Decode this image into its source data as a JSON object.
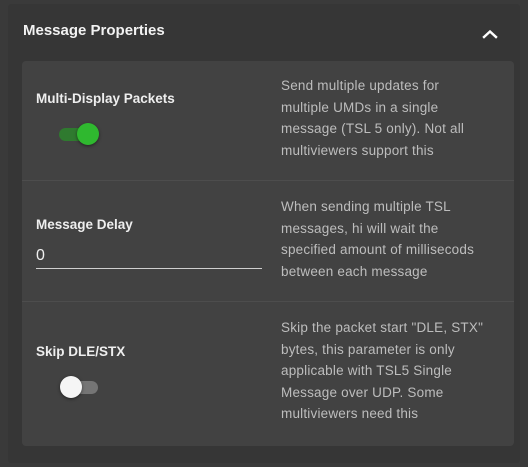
{
  "panel": {
    "title": "Message Properties",
    "collapse_icon": "chevron-up-icon"
  },
  "settings": [
    {
      "label": "Multi-Display Packets",
      "control": "toggle",
      "value": true,
      "description_lines": [
        "Send multiple updates for",
        "multiple UMDs in a single",
        "message (TSL 5 only). Not all",
        "multiviewers support this"
      ]
    },
    {
      "label": "Message Delay",
      "control": "text-field",
      "value": "0",
      "description_lines": [
        "When sending multiple TSL",
        "messages, hi will wait the",
        "specified amount of millisecods",
        "between each message"
      ]
    },
    {
      "label": "Skip DLE/STX",
      "control": "toggle",
      "value": false,
      "description_lines": [
        "Skip the packet start \"DLE, STX\"",
        "bytes, this parameter is only",
        "applicable with TSL5 Single",
        "Message over UDP. Some",
        "multiviewers need this"
      ]
    }
  ],
  "colors": {
    "toggle_on": "#2fb82f",
    "toggle_off": "#f5f5f5"
  }
}
